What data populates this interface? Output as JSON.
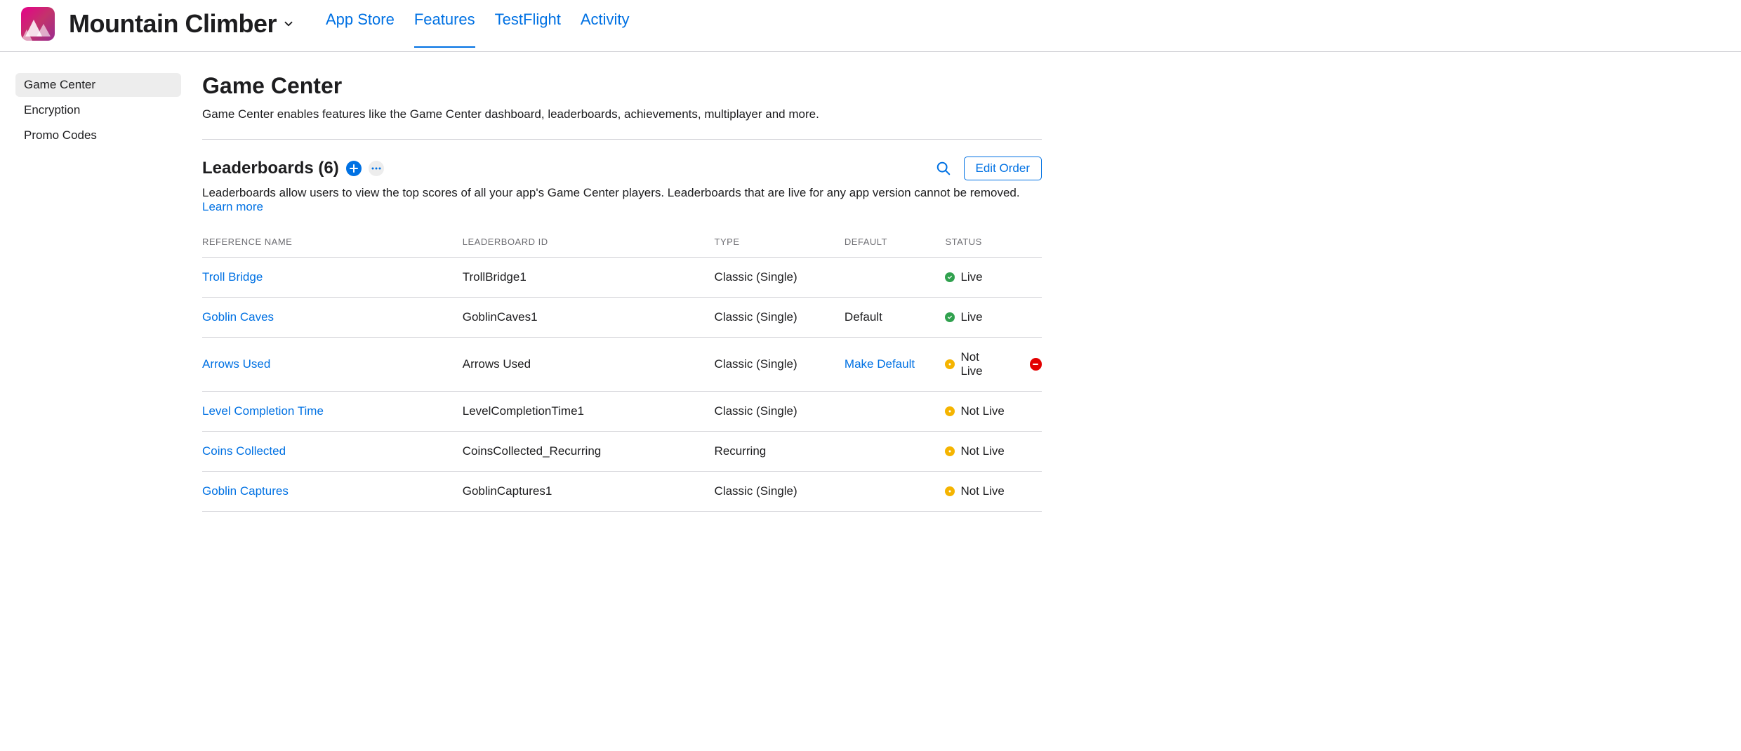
{
  "header": {
    "app_name": "Mountain Climber",
    "tabs": [
      {
        "label": "App Store",
        "active": false
      },
      {
        "label": "Features",
        "active": true
      },
      {
        "label": "TestFlight",
        "active": false
      },
      {
        "label": "Activity",
        "active": false
      }
    ]
  },
  "sidebar": {
    "items": [
      {
        "label": "Game Center",
        "active": true
      },
      {
        "label": "Encryption",
        "active": false
      },
      {
        "label": "Promo Codes",
        "active": false
      }
    ]
  },
  "main": {
    "title": "Game Center",
    "description": "Game Center enables features like the Game Center dashboard, leaderboards, achievements, multiplayer and more.",
    "leaderboards": {
      "heading": "Leaderboards (6)",
      "description": "Leaderboards allow users to view the top scores of all your app's Game Center players. Leaderboards that are live for any app version cannot be removed. ",
      "learn_more": "Learn more",
      "edit_order_label": "Edit Order",
      "columns": {
        "reference": "REFERENCE NAME",
        "id": "LEADERBOARD ID",
        "type": "TYPE",
        "default": "DEFAULT",
        "status": "STATUS"
      },
      "rows": [
        {
          "name": "Troll Bridge",
          "id": "TrollBridge1",
          "type": "Classic (Single)",
          "default": "",
          "default_link": false,
          "status": "Live",
          "status_kind": "live",
          "removable": false
        },
        {
          "name": "Goblin Caves",
          "id": "GoblinCaves1",
          "type": "Classic (Single)",
          "default": "Default",
          "default_link": false,
          "status": "Live",
          "status_kind": "live",
          "removable": false
        },
        {
          "name": "Arrows Used",
          "id": "Arrows Used",
          "type": "Classic (Single)",
          "default": "Make Default",
          "default_link": true,
          "status": "Not Live",
          "status_kind": "notlive",
          "removable": true
        },
        {
          "name": "Level Completion Time",
          "id": "LevelCompletionTime1",
          "type": "Classic (Single)",
          "default": "",
          "default_link": false,
          "status": "Not Live",
          "status_kind": "notlive",
          "removable": false
        },
        {
          "name": "Coins Collected",
          "id": "CoinsCollected_Recurring",
          "type": "Recurring",
          "default": "",
          "default_link": false,
          "status": "Not Live",
          "status_kind": "notlive",
          "removable": false
        },
        {
          "name": "Goblin Captures",
          "id": "GoblinCaptures1",
          "type": "Classic (Single)",
          "default": "",
          "default_link": false,
          "status": "Not Live",
          "status_kind": "notlive",
          "removable": false
        }
      ]
    }
  }
}
